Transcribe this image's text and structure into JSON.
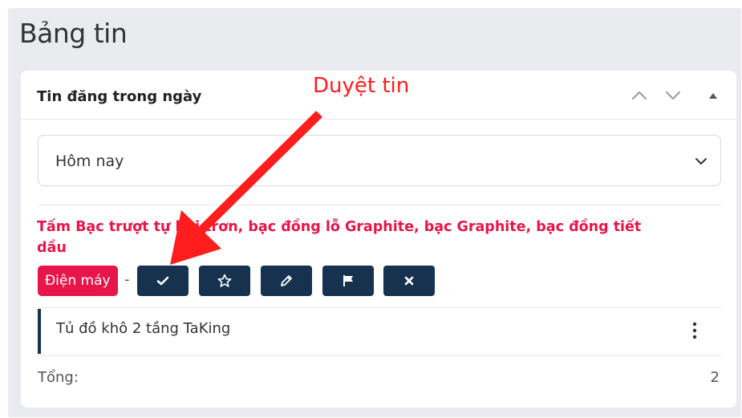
{
  "page": {
    "title": "Bảng tin"
  },
  "widget": {
    "title": "Tin đăng trong ngày"
  },
  "annotation": {
    "text": "Duyệt tin"
  },
  "filter": {
    "selected": "Hôm nay"
  },
  "post": {
    "title": "Tấm Bạc trượt tự bôi trơn, bạc đồng lỗ Graphite, bạc Graphite, bạc đồng tiết dầu",
    "category": "Điện máy",
    "separator": "-"
  },
  "actions": [
    {
      "name": "approve",
      "icon": "check-icon"
    },
    {
      "name": "favorite",
      "icon": "star-icon"
    },
    {
      "name": "edit",
      "icon": "pencil-icon"
    },
    {
      "name": "flag",
      "icon": "flag-icon"
    },
    {
      "name": "delete",
      "icon": "close-icon"
    }
  ],
  "list": [
    {
      "label": "Tủ đồ khô 2 tầng TaKing"
    }
  ],
  "footer": {
    "total_label": "Tổng:",
    "total_value": "2"
  },
  "colors": {
    "accent": "#e8154a",
    "button": "#16324f",
    "annotation": "#ff1d1d"
  }
}
